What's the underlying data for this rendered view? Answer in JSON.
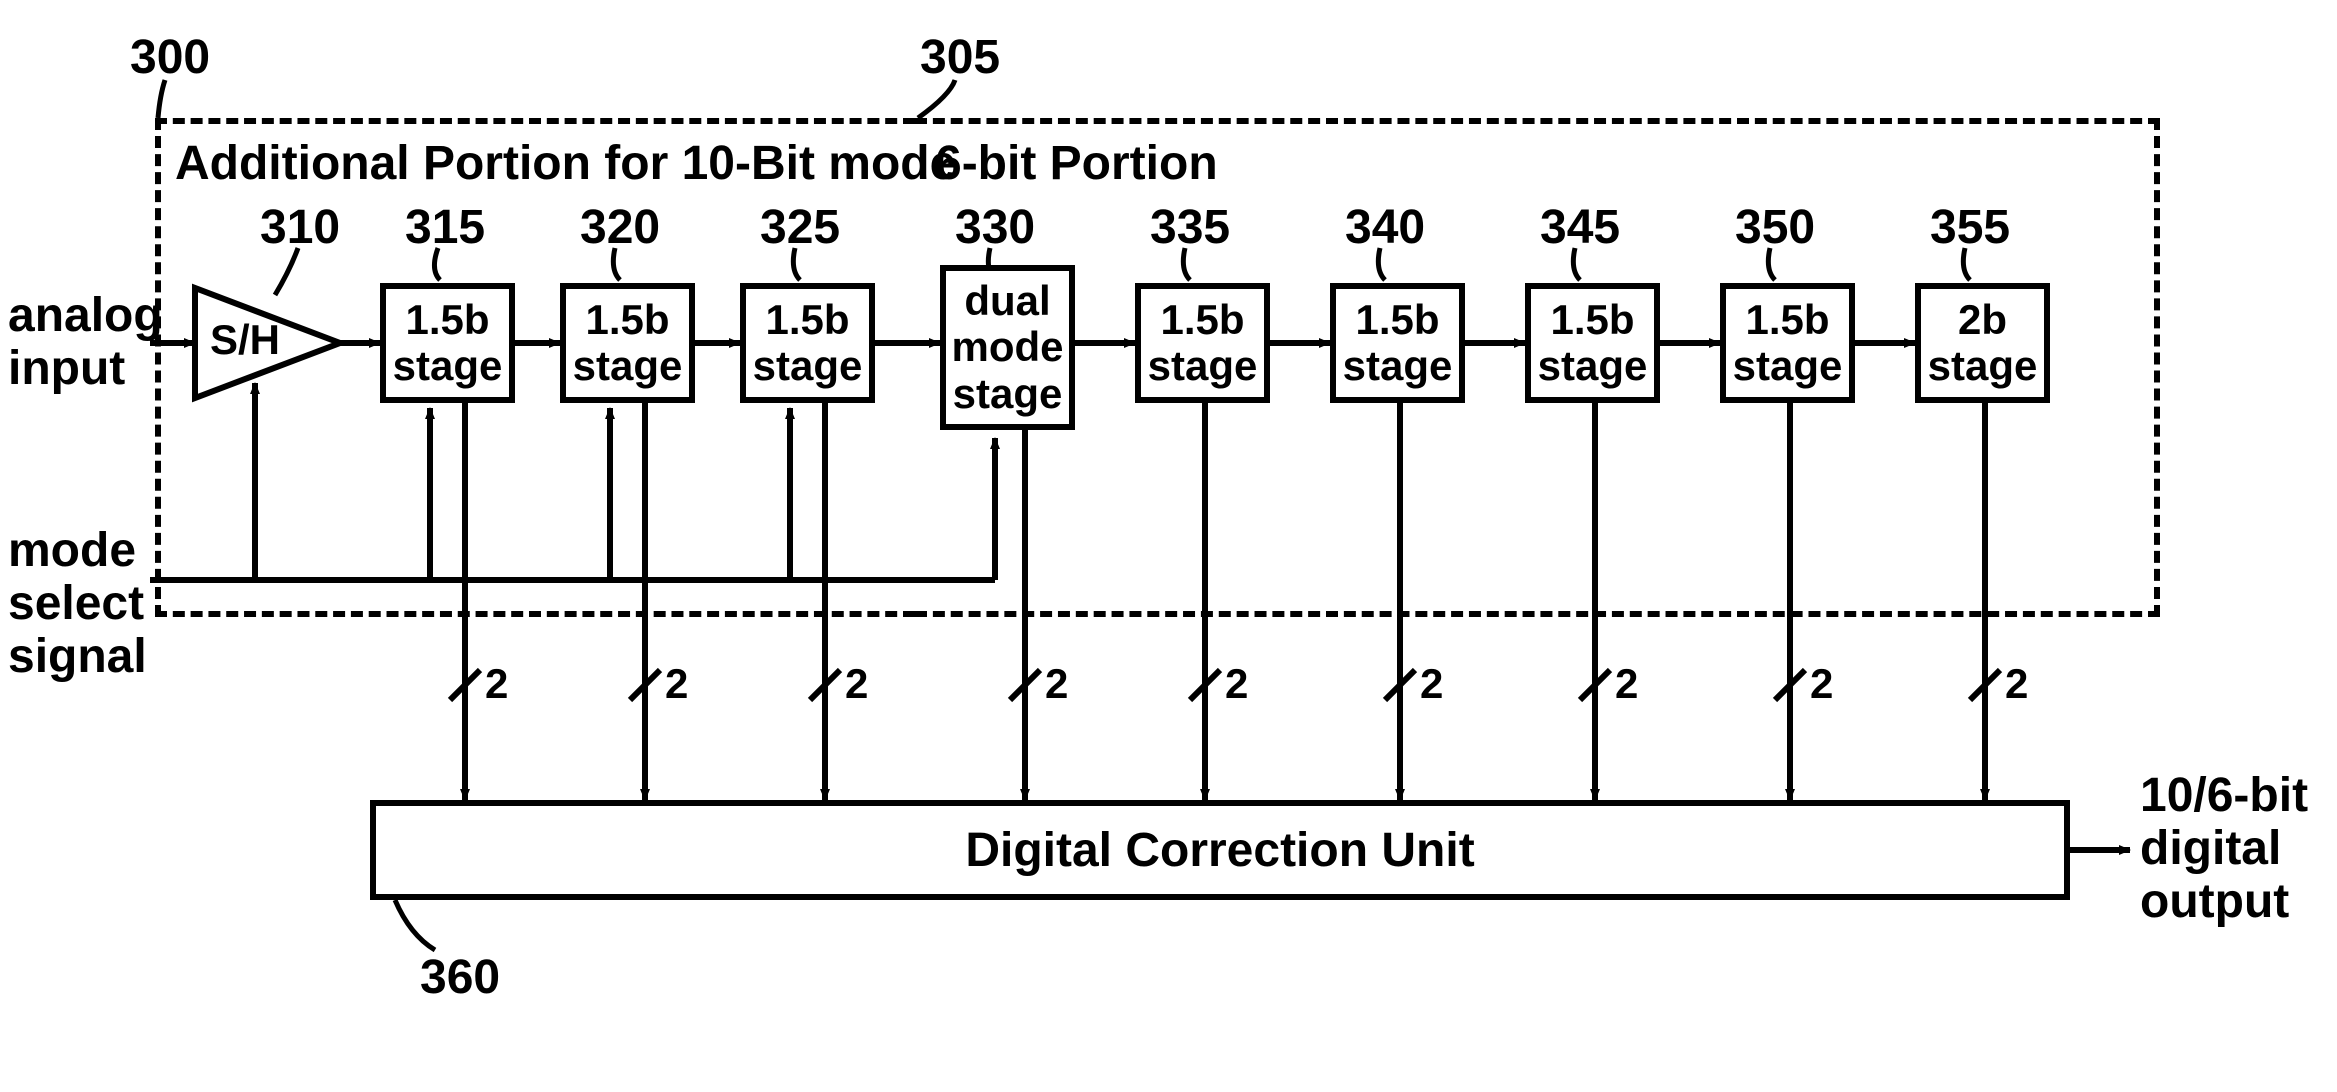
{
  "refs": {
    "r300": "300",
    "r305": "305",
    "r310": "310",
    "r315": "315",
    "r320": "320",
    "r325": "325",
    "r330": "330",
    "r335": "335",
    "r340": "340",
    "r345": "345",
    "r350": "350",
    "r355": "355",
    "r360": "360"
  },
  "labels": {
    "analog_input": "analog\ninput",
    "mode_select": "mode\nselect\nsignal",
    "output": "10/6-bit\ndigital\noutput",
    "additional_portion": "Additional Portion for 10-Bit mode",
    "sixbit_portion": "6-bit Portion",
    "sh": "S/H",
    "stage15b": "1.5b\nstage",
    "dual_mode": "dual\nmode\nstage",
    "stage2b": "2b\nstage",
    "dcu": "Digital Correction Unit",
    "bit2": "2"
  }
}
